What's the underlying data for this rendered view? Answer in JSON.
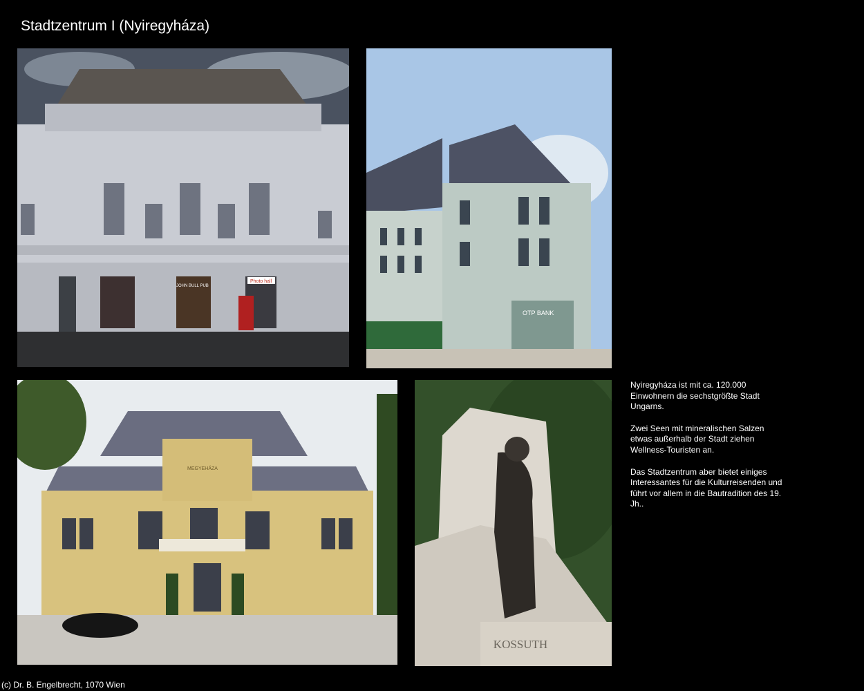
{
  "page": {
    "title": "Stadtzentrum I (Nyiregyháza)",
    "footer": "(c) Dr. B. Engelbrecht, 1070 Wien"
  },
  "description": {
    "paragraphs": [
      "Nyiregyháza ist mit ca. 120.000 Einwohnern die sechstgrößte Stadt Ungarns.",
      "Zwei Seen mit mineralischen Salzen etwas außerhalb der Stadt ziehen Wellness-Touristen an.",
      "Das Stadtzentrum aber bietet einiges Interessantes für die Kulturreisenden und führt vor allem in die Bautradition des 19. Jh.."
    ]
  },
  "photos": {
    "shop_signs": [
      "Photo hall",
      "JOHN BULL PUB"
    ],
    "bank_sign": "OTP BANK",
    "county_hall_sign": "MEGYEHÁZA",
    "statue_inscription": "KOSSUTH"
  },
  "colors": {
    "background": "#000000",
    "text": "#ffffff"
  }
}
